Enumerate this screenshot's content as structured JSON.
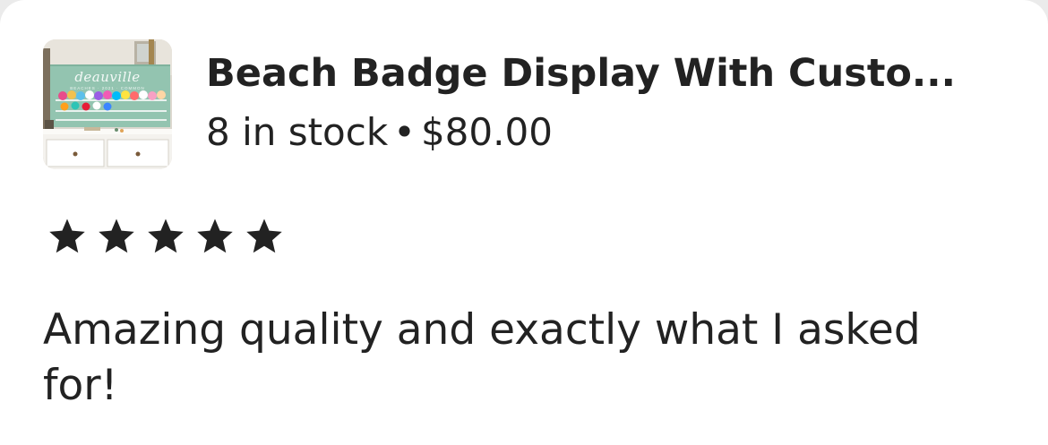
{
  "listing": {
    "title": "Beach Badge Display With Custo...",
    "stock": "8 in stock",
    "separator": "•",
    "price": "$80.00",
    "thumbnail": {
      "brand_text": "deauville",
      "sub_text": "BEACHES · 2021 · COMMON"
    }
  },
  "rating": {
    "stars": 5,
    "max": 5,
    "icon": "star-icon"
  },
  "review": {
    "text": "Amazing quality and exactly what I asked for!"
  },
  "colors": {
    "text": "#222222",
    "background": "#ffffff",
    "star": "#222222"
  }
}
